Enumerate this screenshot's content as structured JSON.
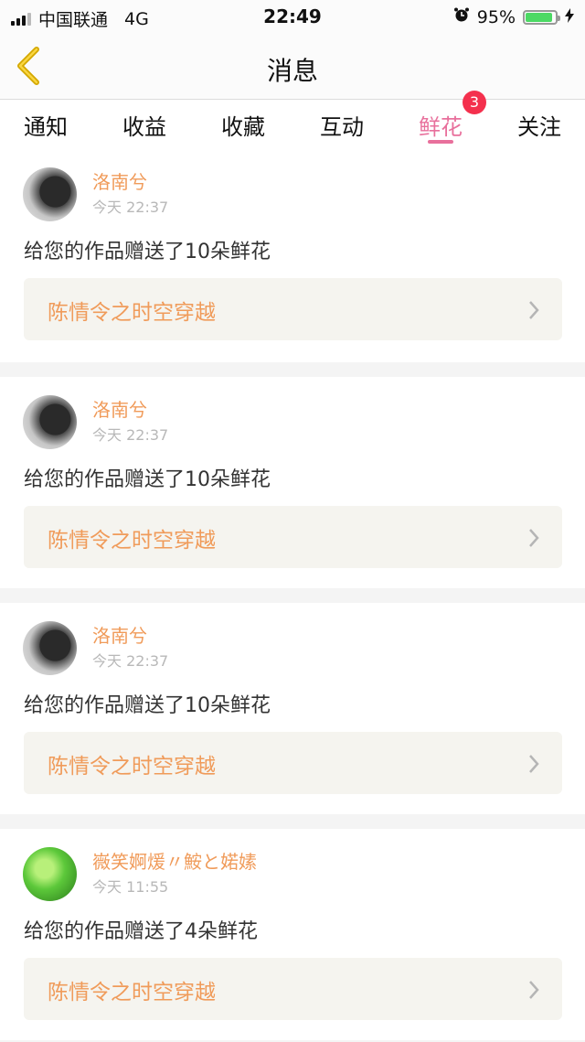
{
  "status_bar": {
    "carrier": "中国联通",
    "network": "4G",
    "time": "22:49",
    "battery": "95%"
  },
  "header": {
    "title": "消息"
  },
  "tabs": [
    {
      "label": "通知"
    },
    {
      "label": "收益"
    },
    {
      "label": "收藏"
    },
    {
      "label": "互动"
    },
    {
      "label": "鲜花",
      "badge": "3",
      "active": true
    },
    {
      "label": "关注"
    }
  ],
  "messages": [
    {
      "user": "洛南兮",
      "time": "今天 22:37",
      "text": "给您的作品赠送了10朵鲜花",
      "work": "陈情令之时空穿越"
    },
    {
      "user": "洛南兮",
      "time": "今天 22:37",
      "text": "给您的作品赠送了10朵鲜花",
      "work": "陈情令之时空穿越"
    },
    {
      "user": "洛南兮",
      "time": "今天 22:37",
      "text": "给您的作品赠送了10朵鲜花",
      "work": "陈情令之时空穿越"
    },
    {
      "user": "嶶笑婀煖〃鮟と婼嫊",
      "time": "今天 11:55",
      "text": "给您的作品赠送了4朵鲜花",
      "work": "陈情令之时空穿越"
    }
  ],
  "colors": {
    "accent": "#e8709c",
    "name": "#f09b5a",
    "badge": "#f4304d"
  }
}
